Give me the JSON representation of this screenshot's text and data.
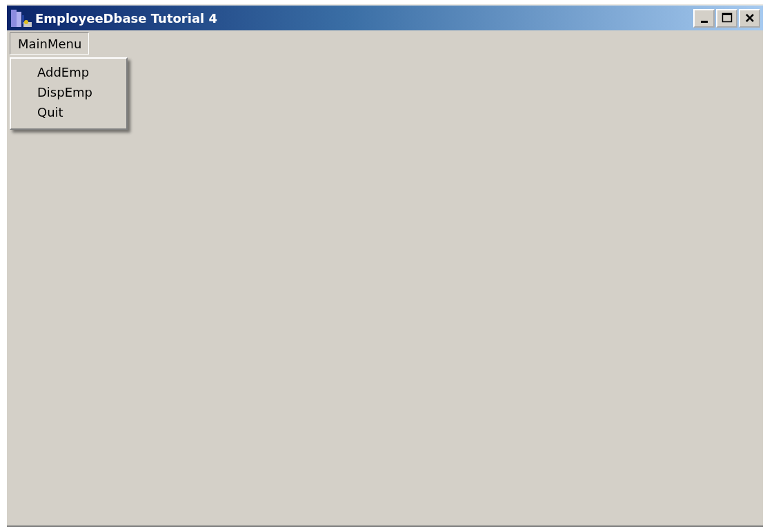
{
  "window": {
    "title": "EmployeeDbase Tutorial 4"
  },
  "menu_bar": [
    {
      "label": "MainMenu",
      "expanded": true,
      "items": [
        {
          "label": "AddEmp"
        },
        {
          "label": "DispEmp"
        },
        {
          "label": "Quit"
        }
      ]
    }
  ]
}
